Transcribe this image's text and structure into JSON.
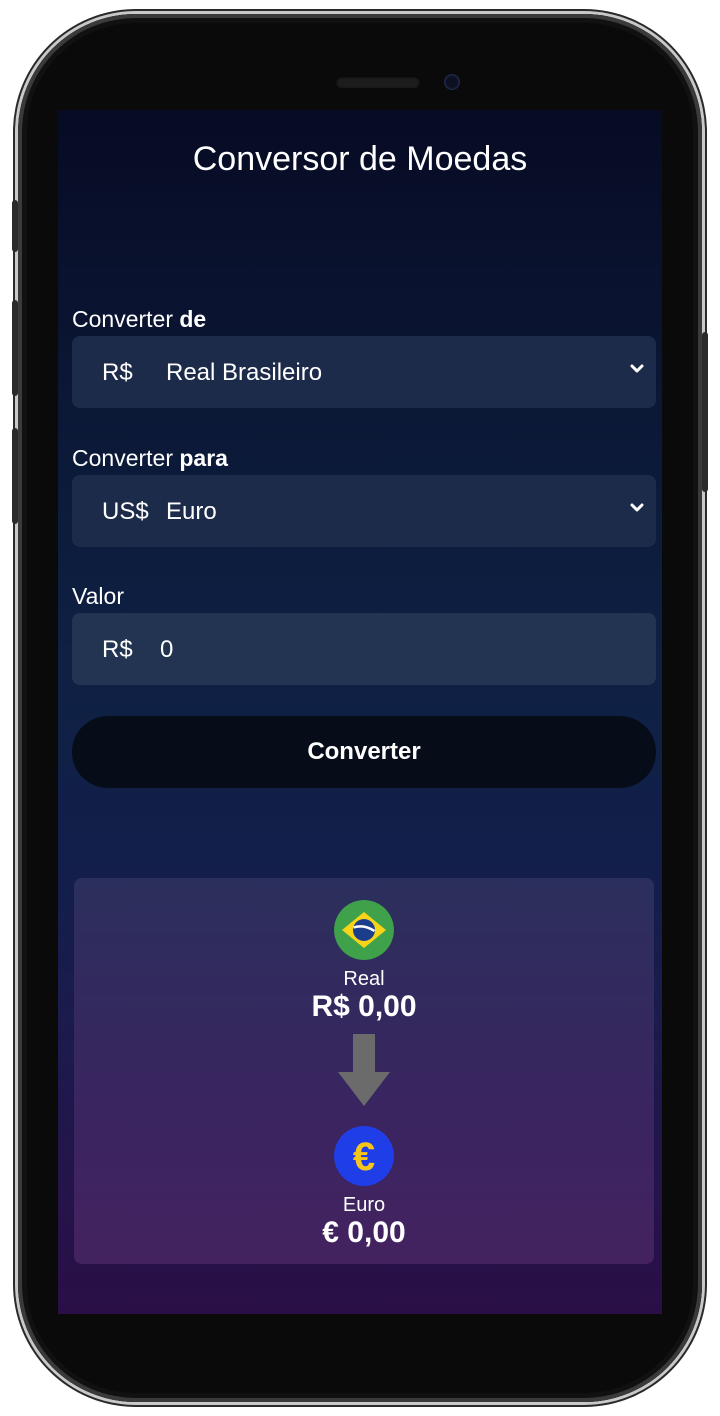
{
  "app": {
    "title": "Conversor de Moedas"
  },
  "from": {
    "label_prefix": "Converter ",
    "label_bold": "de",
    "symbol": "R$",
    "value": "Real Brasileiro"
  },
  "to": {
    "label_prefix": "Converter ",
    "label_bold": "para",
    "symbol": "US$",
    "value": "Euro"
  },
  "amount": {
    "label": "Valor",
    "symbol": "R$",
    "value": "0"
  },
  "convert_button": "Converter",
  "result": {
    "source_name": "Real",
    "source_value": "R$ 0,00",
    "target_name": "Euro",
    "target_value": "€ 0,00",
    "euro_glyph": "€"
  },
  "colors": {
    "flag_green": "#3fa24a",
    "flag_yellow": "#f7d417",
    "flag_blue": "#1b3e8c",
    "euro_blue": "#1f3ee8",
    "euro_yellow": "#f6c51b",
    "arrow_gray": "#6b6b6b"
  },
  "icons": {
    "source_flag": "brazil-flag-icon",
    "target_flag": "euro-icon",
    "arrow": "arrow-down-icon",
    "select_chevron": "chevron-down-icon"
  }
}
